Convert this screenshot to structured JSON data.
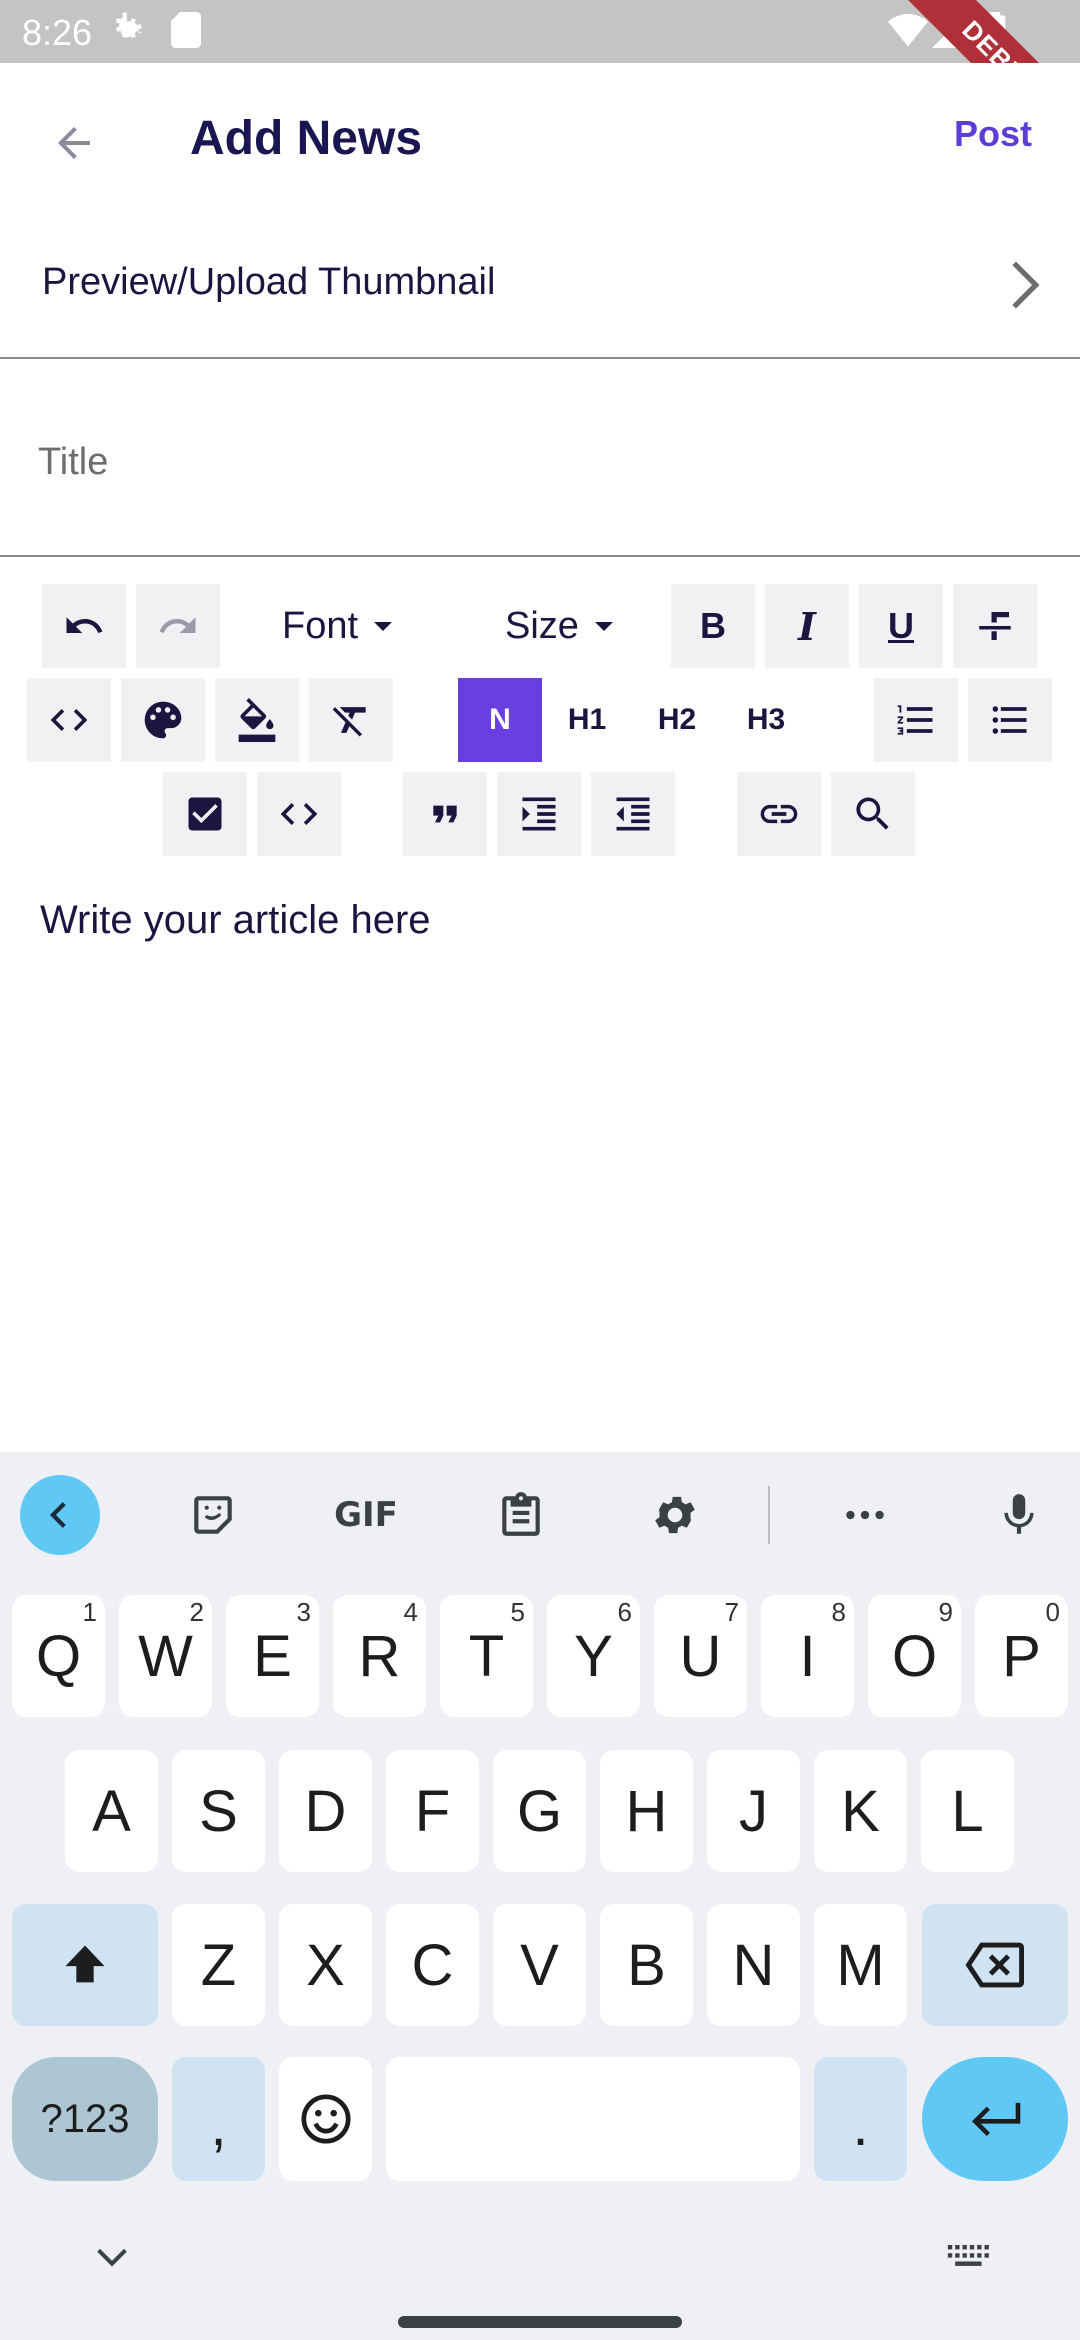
{
  "status_bar": {
    "time": "8:26",
    "debug_label": "DEBUG"
  },
  "app_bar": {
    "title": "Add News",
    "post_label": "Post"
  },
  "thumbnail_row": {
    "label": "Preview/Upload Thumbnail"
  },
  "title_field": {
    "placeholder": "Title"
  },
  "toolbar": {
    "font_label": "Font",
    "size_label": "Size",
    "bold": "B",
    "italic": "I",
    "underline": "U",
    "normal": "N",
    "h1": "H1",
    "h2": "H2",
    "h3": "H3",
    "selected_style": "N"
  },
  "editor": {
    "placeholder": "Write your article here"
  },
  "keyboard": {
    "tools": {
      "gif": "GIF"
    },
    "row1": [
      {
        "k": "Q",
        "h": "1"
      },
      {
        "k": "W",
        "h": "2"
      },
      {
        "k": "E",
        "h": "3"
      },
      {
        "k": "R",
        "h": "4"
      },
      {
        "k": "T",
        "h": "5"
      },
      {
        "k": "Y",
        "h": "6"
      },
      {
        "k": "U",
        "h": "7"
      },
      {
        "k": "I",
        "h": "8"
      },
      {
        "k": "O",
        "h": "9"
      },
      {
        "k": "P",
        "h": "0"
      }
    ],
    "row2": [
      "A",
      "S",
      "D",
      "F",
      "G",
      "H",
      "J",
      "K",
      "L"
    ],
    "row3": [
      "Z",
      "X",
      "C",
      "V",
      "B",
      "N",
      "M"
    ],
    "symbols_label": "?123",
    "comma": ",",
    "period": "."
  },
  "colors": {
    "accent": "#6a3fe0",
    "post": "#5c3ed6",
    "title_text": "#1b1652",
    "keyboard_bg": "#eef0f4",
    "key_mod": "#cfe3f3",
    "key_enter": "#5fc8f5"
  }
}
